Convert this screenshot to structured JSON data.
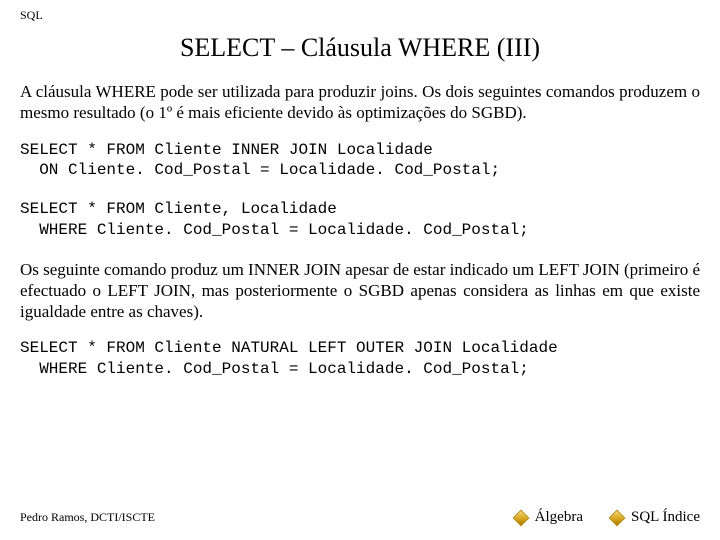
{
  "header": {
    "label": "SQL"
  },
  "title": "SELECT – Cláusula WHERE (III)",
  "para1": "A cláusula WHERE pode ser utilizada para produzir joins. Os dois seguintes comandos produzem o mesmo resultado (o 1º é mais eficiente devido às optimizações do SGBD).",
  "code1": "SELECT * FROM Cliente INNER JOIN Localidade\n  ON Cliente. Cod_Postal = Localidade. Cod_Postal;",
  "code2": "SELECT * FROM Cliente, Localidade\n  WHERE Cliente. Cod_Postal = Localidade. Cod_Postal;",
  "para2": "Os seguinte comando produz um INNER JOIN apesar de estar indicado um LEFT JOIN (primeiro é efectuado o LEFT JOIN, mas posteriormente o SGBD apenas considera as linhas em que existe igualdade entre as chaves).",
  "code3": "SELECT * FROM Cliente NATURAL LEFT OUTER JOIN Localidade\n  WHERE Cliente. Cod_Postal = Localidade. Cod_Postal;",
  "footer": {
    "author": "Pedro Ramos, DCTI/ISCTE",
    "link1": "Álgebra",
    "link2": "SQL Índice"
  }
}
